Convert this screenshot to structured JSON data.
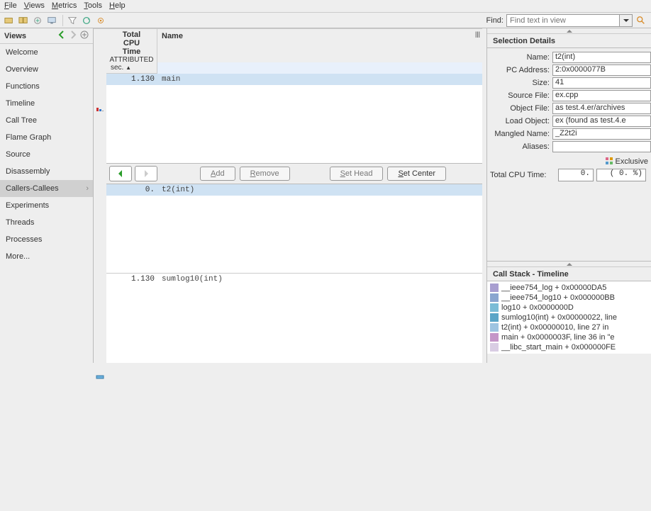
{
  "menu": {
    "file": "File",
    "views": "Views",
    "metrics": "Metrics",
    "tools": "Tools",
    "help": "Help"
  },
  "find": {
    "label": "Find:",
    "placeholder": "Find text in view"
  },
  "sidebar": {
    "title": "Views",
    "items": [
      {
        "label": "Welcome"
      },
      {
        "label": "Overview"
      },
      {
        "label": "Functions"
      },
      {
        "label": "Timeline"
      },
      {
        "label": "Call Tree"
      },
      {
        "label": "Flame Graph"
      },
      {
        "label": "Source"
      },
      {
        "label": "Disassembly"
      },
      {
        "label": "Callers-Callees"
      },
      {
        "label": "Experiments"
      },
      {
        "label": "Threads"
      },
      {
        "label": "Processes"
      },
      {
        "label": "More..."
      }
    ]
  },
  "columns": {
    "time_h": "Total\nCPU\nTime",
    "time_attr": "ATTRIBUTED",
    "time_unit": "sec.",
    "name": "Name"
  },
  "callers": [
    {
      "time": "1.130",
      "name": "main"
    }
  ],
  "focus": [
    {
      "time": "0.",
      "name": "t2(int)"
    }
  ],
  "callees": [
    {
      "time": "1.130",
      "name": "sumlog10(int)"
    }
  ],
  "mid_toolbar": {
    "add": "Add",
    "remove": "Remove",
    "set_head": "Set Head",
    "set_center": "Set Center"
  },
  "selection_details": {
    "title": "Selection Details",
    "name_l": "Name:",
    "name_v": "t2(int)",
    "pc_l": "PC Address:",
    "pc_v": "2:0x0000077B",
    "size_l": "Size:",
    "size_v": "41",
    "src_l": "Source File:",
    "src_v": "ex.cpp",
    "obj_l": "Object File:",
    "obj_v": "as test.4.er/archives",
    "load_l": "Load Object:",
    "load_v": "ex (found as test.4.e",
    "mang_l": "Mangled Name:",
    "mang_v": "_Z2t2i",
    "alias_l": "Aliases:",
    "alias_v": "",
    "exclusive": "Exclusive",
    "cpu_l": "Total CPU Time:",
    "cpu_v1": "0.",
    "cpu_v2": "(  0.  %)"
  },
  "callstack": {
    "title": "Call Stack - Timeline",
    "items": [
      {
        "color": "#a89ed0",
        "label": "__ieee754_log + 0x00000DA5"
      },
      {
        "color": "#8aa5cf",
        "label": "__ieee754_log10 + 0x000000BB"
      },
      {
        "color": "#7bbcd6",
        "label": "log10 + 0x0000000D"
      },
      {
        "color": "#5ba5c7",
        "label": "sumlog10(int) + 0x00000022, line"
      },
      {
        "color": "#9ec4e1",
        "label": "t2(int) + 0x00000010, line 27 in"
      },
      {
        "color": "#c496c8",
        "label": "main + 0x0000003F, line 36 in \"e"
      },
      {
        "color": "#d9cde3",
        "label": "__libc_start_main + 0x000000FE"
      }
    ]
  }
}
